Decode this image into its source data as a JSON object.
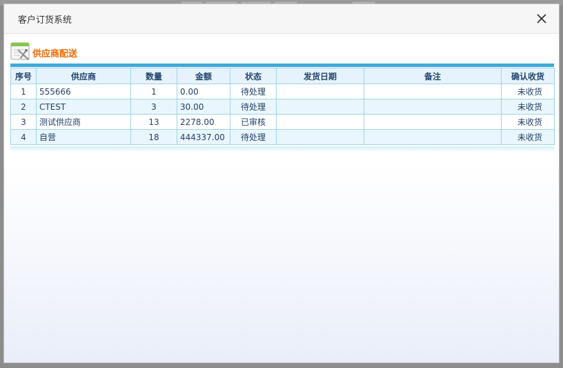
{
  "dialog": {
    "title": "客户订货系统"
  },
  "section": {
    "title": "供应商配送",
    "icon": "delivery-document-icon"
  },
  "table": {
    "headers": [
      "序号",
      "供应商",
      "数量",
      "金额",
      "状态",
      "发货日期",
      "备注",
      "确认收货"
    ],
    "rows": [
      {
        "index": "1",
        "supplier": "555666",
        "quantity": "1",
        "amount": "0.00",
        "status": "待处理",
        "ship_date": "",
        "remark": "",
        "confirm": "未收货"
      },
      {
        "index": "2",
        "supplier": "CTEST",
        "quantity": "3",
        "amount": "30.00",
        "status": "待处理",
        "ship_date": "",
        "remark": "",
        "confirm": "未收货"
      },
      {
        "index": "3",
        "supplier": "测试供应商",
        "quantity": "13",
        "amount": "2278.00",
        "status": "已审核",
        "ship_date": "",
        "remark": "",
        "confirm": "未收货"
      },
      {
        "index": "4",
        "supplier": "自营",
        "quantity": "18",
        "amount": "444337.00",
        "status": "待处理",
        "ship_date": "",
        "remark": "",
        "confirm": "未收货"
      }
    ]
  },
  "colors": {
    "accent_orange": "#f06a00",
    "header_blue": "#3fa9dc",
    "grid_border": "#9cd3ec"
  }
}
